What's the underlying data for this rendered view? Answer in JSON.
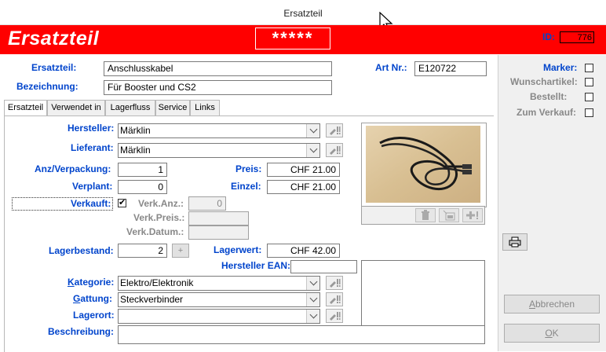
{
  "window": {
    "title": "Ersatzteil"
  },
  "header": {
    "title": "Ersatzteil",
    "stars": "*****",
    "id_label": "ID:",
    "id_value": "776"
  },
  "main": {
    "ersatzteil_label": "Ersatzteil:",
    "ersatzteil_value": "Anschlusskabel",
    "bezeichnung_label": "Bezeichnung:",
    "bezeichnung_value": "Für Booster und CS2",
    "artnr_label": "Art Nr.:",
    "artnr_value": "E120722"
  },
  "tabs": [
    {
      "label": "Ersatzteil",
      "active": true
    },
    {
      "label": "Verwendet in",
      "active": false
    },
    {
      "label": "Lagerfluss",
      "active": false
    },
    {
      "label": "Service",
      "active": false
    },
    {
      "label": "Links",
      "active": false
    }
  ],
  "form": {
    "hersteller_label": "Hersteller:",
    "hersteller_value": "Märklin",
    "lieferant_label": "Lieferant:",
    "lieferant_value": "Märklin",
    "anz_label": "Anz/Verpackung:",
    "anz_value": "1",
    "verplant_label": "Verplant:",
    "verplant_value": "0",
    "verkauft_label": "Verkauft:",
    "verkauft_checked": true,
    "preis_label": "Preis:",
    "preis_value": "CHF 21.00",
    "einzel_label": "Einzel:",
    "einzel_value": "CHF 21.00",
    "verk_anz_label": "Verk.Anz.:",
    "verk_anz_value": "0",
    "verk_preis_label": "Verk.Preis.:",
    "verk_preis_value": "",
    "verk_datum_label": "Verk.Datum.:",
    "verk_datum_value": "",
    "lagerbestand_label": "Lagerbestand:",
    "lagerbestand_value": "2",
    "plus_button": "+",
    "lagerwert_label": "Lagerwert:",
    "lagerwert_value": "CHF 42.00",
    "ean_label": "Hersteller EAN:",
    "ean_value": "",
    "kategorie_label_u": "K",
    "kategorie_label_rest": "ategorie:",
    "kategorie_value": "Elektro/Elektronik",
    "gattung_label_u": "G",
    "gattung_label_rest": "attung:",
    "gattung_value": "Steckverbinder",
    "lagerort_label": "Lagerort:",
    "lagerort_value": "",
    "beschreibung_label": "Beschreibung:",
    "beschreibung_value": ""
  },
  "sidepanel": {
    "marker_label": "Marker:",
    "wunschartikel_label": "Wunschartikel:",
    "bestellt_label": "Bestellt:",
    "zum_verkauf_label": "Zum Verkauf:",
    "abbrechen_u": "A",
    "abbrechen_rest": "bbrechen",
    "ok_u": "O",
    "ok_rest": "K"
  },
  "icons": [
    "edit-icon",
    "delete-icon",
    "import-image-icon",
    "add-image-icon",
    "print-icon",
    "cursor-icon"
  ],
  "colors": {
    "header_red": "#ff0000",
    "label_blue": "#0044cc",
    "panel_gray": "#f0f0f0"
  }
}
